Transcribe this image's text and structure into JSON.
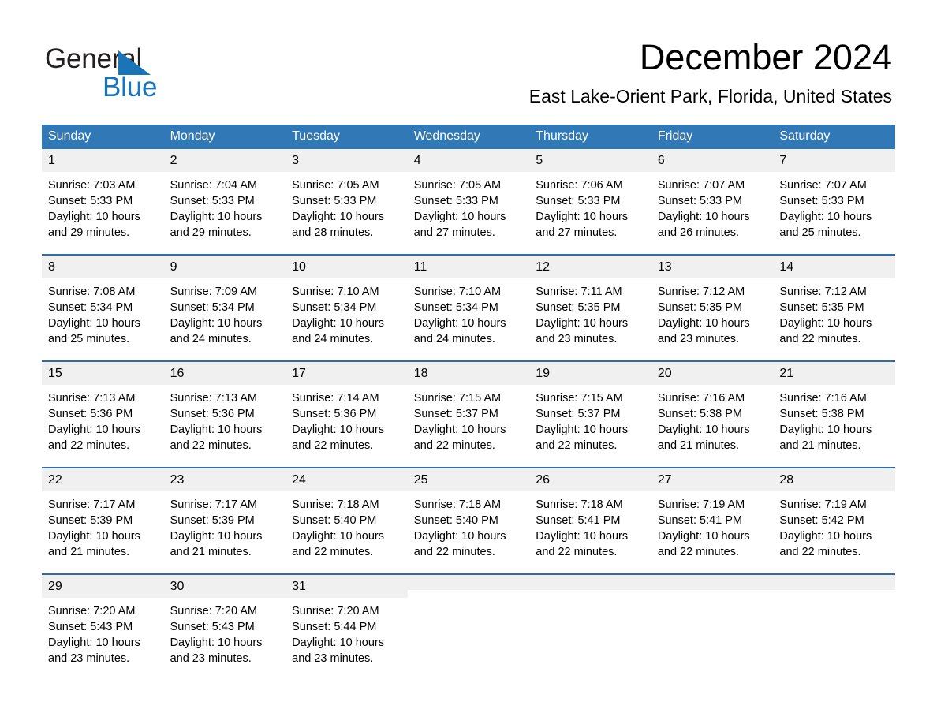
{
  "brand": {
    "name_part1": "General",
    "name_part2": "Blue",
    "triangle_color": "#1a74b8"
  },
  "header": {
    "title": "December 2024",
    "subtitle": "East Lake-Orient Park, Florida, United States"
  },
  "theme": {
    "header_blue": "#3178b6",
    "row_divider_blue": "#2f6da8",
    "daynum_band": "#f0f0f0"
  },
  "calendar": {
    "weekday_headers": [
      "Sunday",
      "Monday",
      "Tuesday",
      "Wednesday",
      "Thursday",
      "Friday",
      "Saturday"
    ],
    "weeks": [
      [
        {
          "day": "1",
          "sunrise": "Sunrise: 7:03 AM",
          "sunset": "Sunset: 5:33 PM",
          "daylight": "Daylight: 10 hours and 29 minutes."
        },
        {
          "day": "2",
          "sunrise": "Sunrise: 7:04 AM",
          "sunset": "Sunset: 5:33 PM",
          "daylight": "Daylight: 10 hours and 29 minutes."
        },
        {
          "day": "3",
          "sunrise": "Sunrise: 7:05 AM",
          "sunset": "Sunset: 5:33 PM",
          "daylight": "Daylight: 10 hours and 28 minutes."
        },
        {
          "day": "4",
          "sunrise": "Sunrise: 7:05 AM",
          "sunset": "Sunset: 5:33 PM",
          "daylight": "Daylight: 10 hours and 27 minutes."
        },
        {
          "day": "5",
          "sunrise": "Sunrise: 7:06 AM",
          "sunset": "Sunset: 5:33 PM",
          "daylight": "Daylight: 10 hours and 27 minutes."
        },
        {
          "day": "6",
          "sunrise": "Sunrise: 7:07 AM",
          "sunset": "Sunset: 5:33 PM",
          "daylight": "Daylight: 10 hours and 26 minutes."
        },
        {
          "day": "7",
          "sunrise": "Sunrise: 7:07 AM",
          "sunset": "Sunset: 5:33 PM",
          "daylight": "Daylight: 10 hours and 25 minutes."
        }
      ],
      [
        {
          "day": "8",
          "sunrise": "Sunrise: 7:08 AM",
          "sunset": "Sunset: 5:34 PM",
          "daylight": "Daylight: 10 hours and 25 minutes."
        },
        {
          "day": "9",
          "sunrise": "Sunrise: 7:09 AM",
          "sunset": "Sunset: 5:34 PM",
          "daylight": "Daylight: 10 hours and 24 minutes."
        },
        {
          "day": "10",
          "sunrise": "Sunrise: 7:10 AM",
          "sunset": "Sunset: 5:34 PM",
          "daylight": "Daylight: 10 hours and 24 minutes."
        },
        {
          "day": "11",
          "sunrise": "Sunrise: 7:10 AM",
          "sunset": "Sunset: 5:34 PM",
          "daylight": "Daylight: 10 hours and 24 minutes."
        },
        {
          "day": "12",
          "sunrise": "Sunrise: 7:11 AM",
          "sunset": "Sunset: 5:35 PM",
          "daylight": "Daylight: 10 hours and 23 minutes."
        },
        {
          "day": "13",
          "sunrise": "Sunrise: 7:12 AM",
          "sunset": "Sunset: 5:35 PM",
          "daylight": "Daylight: 10 hours and 23 minutes."
        },
        {
          "day": "14",
          "sunrise": "Sunrise: 7:12 AM",
          "sunset": "Sunset: 5:35 PM",
          "daylight": "Daylight: 10 hours and 22 minutes."
        }
      ],
      [
        {
          "day": "15",
          "sunrise": "Sunrise: 7:13 AM",
          "sunset": "Sunset: 5:36 PM",
          "daylight": "Daylight: 10 hours and 22 minutes."
        },
        {
          "day": "16",
          "sunrise": "Sunrise: 7:13 AM",
          "sunset": "Sunset: 5:36 PM",
          "daylight": "Daylight: 10 hours and 22 minutes."
        },
        {
          "day": "17",
          "sunrise": "Sunrise: 7:14 AM",
          "sunset": "Sunset: 5:36 PM",
          "daylight": "Daylight: 10 hours and 22 minutes."
        },
        {
          "day": "18",
          "sunrise": "Sunrise: 7:15 AM",
          "sunset": "Sunset: 5:37 PM",
          "daylight": "Daylight: 10 hours and 22 minutes."
        },
        {
          "day": "19",
          "sunrise": "Sunrise: 7:15 AM",
          "sunset": "Sunset: 5:37 PM",
          "daylight": "Daylight: 10 hours and 22 minutes."
        },
        {
          "day": "20",
          "sunrise": "Sunrise: 7:16 AM",
          "sunset": "Sunset: 5:38 PM",
          "daylight": "Daylight: 10 hours and 21 minutes."
        },
        {
          "day": "21",
          "sunrise": "Sunrise: 7:16 AM",
          "sunset": "Sunset: 5:38 PM",
          "daylight": "Daylight: 10 hours and 21 minutes."
        }
      ],
      [
        {
          "day": "22",
          "sunrise": "Sunrise: 7:17 AM",
          "sunset": "Sunset: 5:39 PM",
          "daylight": "Daylight: 10 hours and 21 minutes."
        },
        {
          "day": "23",
          "sunrise": "Sunrise: 7:17 AM",
          "sunset": "Sunset: 5:39 PM",
          "daylight": "Daylight: 10 hours and 21 minutes."
        },
        {
          "day": "24",
          "sunrise": "Sunrise: 7:18 AM",
          "sunset": "Sunset: 5:40 PM",
          "daylight": "Daylight: 10 hours and 22 minutes."
        },
        {
          "day": "25",
          "sunrise": "Sunrise: 7:18 AM",
          "sunset": "Sunset: 5:40 PM",
          "daylight": "Daylight: 10 hours and 22 minutes."
        },
        {
          "day": "26",
          "sunrise": "Sunrise: 7:18 AM",
          "sunset": "Sunset: 5:41 PM",
          "daylight": "Daylight: 10 hours and 22 minutes."
        },
        {
          "day": "27",
          "sunrise": "Sunrise: 7:19 AM",
          "sunset": "Sunset: 5:41 PM",
          "daylight": "Daylight: 10 hours and 22 minutes."
        },
        {
          "day": "28",
          "sunrise": "Sunrise: 7:19 AM",
          "sunset": "Sunset: 5:42 PM",
          "daylight": "Daylight: 10 hours and 22 minutes."
        }
      ],
      [
        {
          "day": "29",
          "sunrise": "Sunrise: 7:20 AM",
          "sunset": "Sunset: 5:43 PM",
          "daylight": "Daylight: 10 hours and 23 minutes."
        },
        {
          "day": "30",
          "sunrise": "Sunrise: 7:20 AM",
          "sunset": "Sunset: 5:43 PM",
          "daylight": "Daylight: 10 hours and 23 minutes."
        },
        {
          "day": "31",
          "sunrise": "Sunrise: 7:20 AM",
          "sunset": "Sunset: 5:44 PM",
          "daylight": "Daylight: 10 hours and 23 minutes."
        },
        {
          "day": "",
          "sunrise": "",
          "sunset": "",
          "daylight": ""
        },
        {
          "day": "",
          "sunrise": "",
          "sunset": "",
          "daylight": ""
        },
        {
          "day": "",
          "sunrise": "",
          "sunset": "",
          "daylight": ""
        },
        {
          "day": "",
          "sunrise": "",
          "sunset": "",
          "daylight": ""
        }
      ]
    ]
  }
}
